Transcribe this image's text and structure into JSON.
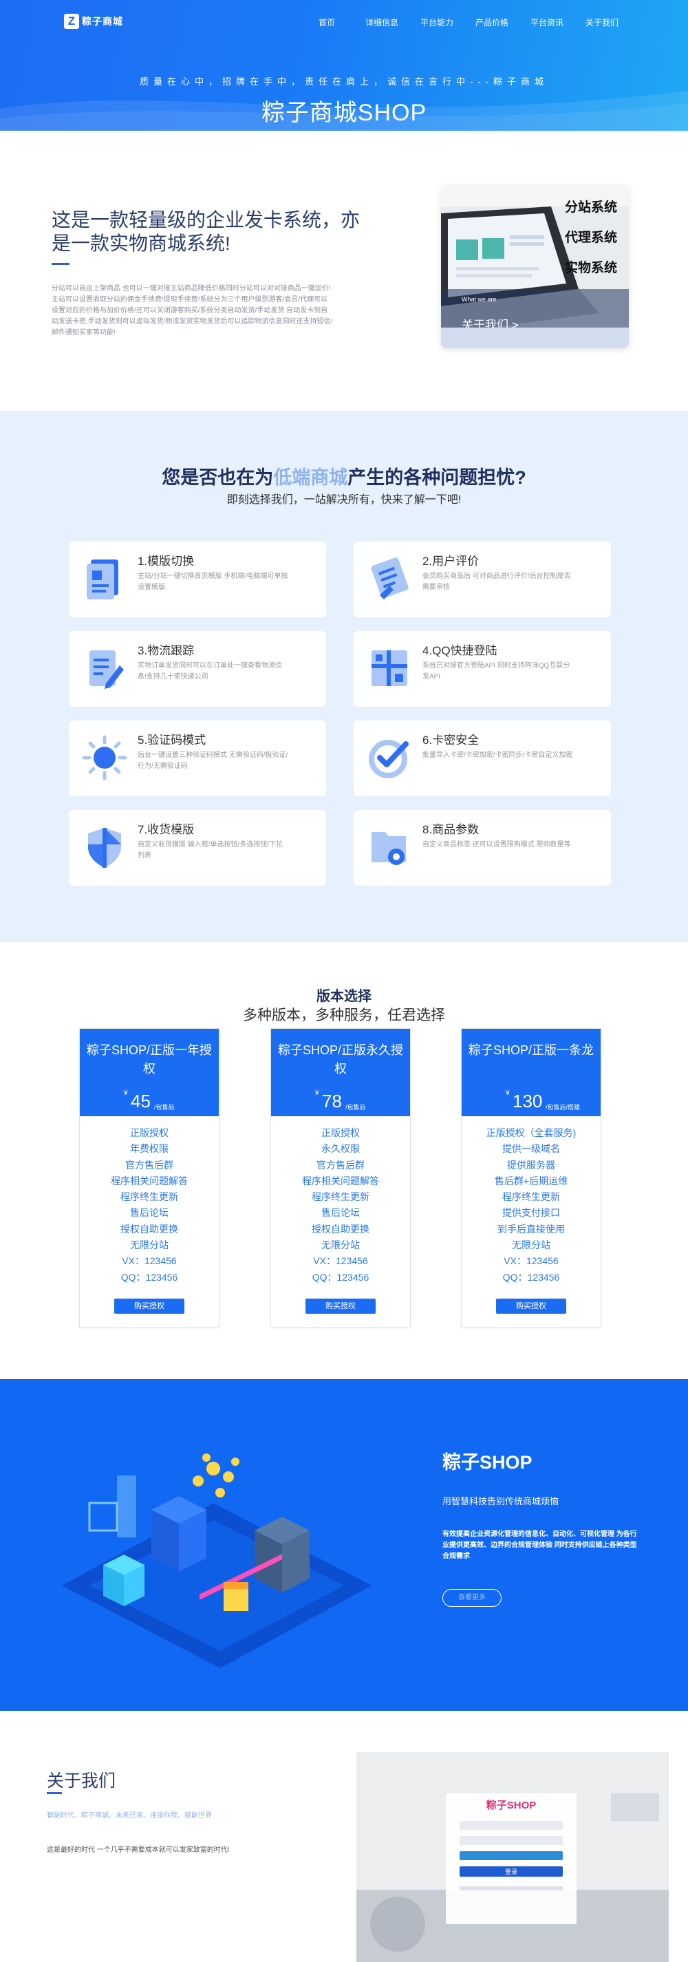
{
  "header": {
    "logo_mark": "Z",
    "logo_text": "粽子商城",
    "nav": [
      "首页",
      "详细信息",
      "平台能力",
      "产品价格",
      "平台资讯",
      "关于我们"
    ],
    "slogan": "质量在心中，招牌在手中，责任在肩上，诚信在言行中---粽子商城",
    "title": "粽子商城SHOP"
  },
  "intro": {
    "title": "这是一款轻量级的企业发卡系统，亦是一款实物商城系统!",
    "description": "分站可以自由上架商品 也可以一键对接主站商品降低价格同时分站可以对对接商品一键加价!主站可以设置收取分站的佣金手续费!提现手续费!系统分为三个用户级别游客/会员/代理可以设置对应的价格与加价价格!还可以关闭游客购买/系统分类自动发货/手动发货 自动发卡到自动发送卡密,手动发货则可以虚拟发货/物流发货实物发货后可以追踪物流信息同时还支持短信/邮件通知买家等功能!",
    "card_tags": [
      "分站系统",
      "代理系统",
      "实物系统"
    ],
    "card_small": "What we are",
    "card_link": "关于我们 >"
  },
  "problems": {
    "title_pre": "您是否也在为",
    "title_hl": "低端商城",
    "title_post": "产生的各种问题担忧?",
    "subtitle": "即刻选择我们，一站解决所有，快来了解一下吧!",
    "items": [
      {
        "title": "1.模版切换",
        "desc": "主站/分站一键切换首页模版 手机端/电脑端可单独设置模版",
        "icon": "template-icon"
      },
      {
        "title": "2.用户评价",
        "desc": "会员购买商品后 可对商品进行评价!后台控制是否需要审核",
        "icon": "review-icon"
      },
      {
        "title": "3.物流跟踪",
        "desc": "实物订单发货同时可以在订单处一键查看物流信息!支持几十家快递公司",
        "icon": "logistics-icon"
      },
      {
        "title": "4.QQ快捷登陆",
        "desc": "系统已对接官方登陆API 同时支持阿洋QQ互联分发API",
        "icon": "qq-login-icon"
      },
      {
        "title": "5.验证码模式",
        "desc": "后台一键设置三种验证码模式 无需验证码/极验证/行为/无需验证码",
        "icon": "captcha-icon"
      },
      {
        "title": "6.卡密安全",
        "desc": "批量导入卡密/卡密加密/卡密同步/卡密自定义加密",
        "icon": "card-security-icon"
      },
      {
        "title": "7.收货模版",
        "desc": "自定义收货模版 输入框/单选按钮/多选按钮/下拉列表",
        "icon": "shield-icon"
      },
      {
        "title": "8.商品参数",
        "desc": "自定义商品标签 还可以设置限购模式 限购数量等",
        "icon": "product-params-icon"
      }
    ]
  },
  "pricing": {
    "title": "版本选择",
    "subtitle": "多种版本，多种服务，任君选择",
    "plans": [
      {
        "name": "粽子SHOP/正版一年授权",
        "currency": "¥",
        "price": "45",
        "unit": "/包售后",
        "features": [
          "正版授权",
          "年费权限",
          "官方售后群",
          "程序相关问题解答",
          "程序终生更新",
          "售后论坛",
          "授权自助更换",
          "无限分站",
          "VX：123456",
          "QQ：123456"
        ],
        "button": "购买授权"
      },
      {
        "name": "粽子SHOP/正版永久授权",
        "currency": "¥",
        "price": "78",
        "unit": "/包售后",
        "features": [
          "正版授权",
          "永久权限",
          "官方售后群",
          "程序相关问题解答",
          "程序终生更新",
          "售后论坛",
          "授权自助更换",
          "无限分站",
          "VX：123456",
          "QQ：123456"
        ],
        "button": "购买授权"
      },
      {
        "name": "粽子SHOP/正版一条龙",
        "currency": "¥",
        "price": "130",
        "unit": "/包售后/搭建",
        "features": [
          "正版授权（全套服务)",
          "提供一级域名",
          "提供服务器",
          "售后群+后期运维",
          "程序终生更新",
          "提供支付接口",
          "到手后直接使用",
          "无限分站",
          "VX：123456",
          "QQ：123456"
        ],
        "button": "购买授权"
      }
    ]
  },
  "banner": {
    "title": "粽子SHOP",
    "subtitle": "用智慧科技告别传统商城烦恼",
    "description": "有效提高企业资源化管理的信息化、自动化、可视化管理 为各行业提供更高效、边界的合规管理体验 同时支持供应链上各种类型合规需求",
    "button": "查看更多"
  },
  "about": {
    "title": "关于我们",
    "tags": "智能时代、粽子商城、未来已来、连接你我、赋能世界",
    "text": "这是最好的时代 一个几乎不需要成本就可以发家致富的时代!",
    "mock_title": "粽子SHOP",
    "mock_btn": "登录"
  },
  "colors": {
    "primary": "#1a6cf3",
    "hero_start": "#1e6df3",
    "hero_end": "#1ea8f4",
    "problems_bg": "#e6f1fd",
    "banner_bg": "#1168f3",
    "heading": "#1f2f5e",
    "highlight": "#8fb3ec",
    "feature_text": "#2b78e4"
  }
}
